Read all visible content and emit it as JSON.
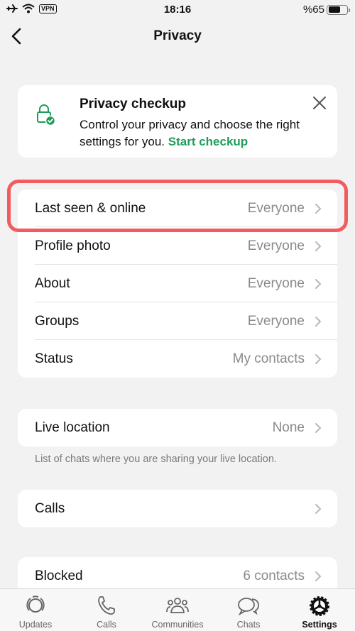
{
  "status_bar": {
    "time": "18:16",
    "vpn_label": "VPN",
    "battery_text": "%65",
    "battery_level_percent": 65,
    "icons": [
      "airplane-icon",
      "wifi-icon",
      "vpn-badge",
      "battery-icon"
    ]
  },
  "header": {
    "title": "Privacy",
    "back_icon": "chevron-left-icon"
  },
  "checkup_card": {
    "title": "Privacy checkup",
    "text": "Control your privacy and choose the right settings for you.",
    "link": "Start checkup",
    "icon": "lock-check-icon",
    "close_icon": "close-icon",
    "accent": "#1e9e5a"
  },
  "privacy_list": [
    {
      "label": "Last seen & online",
      "value": "Everyone"
    },
    {
      "label": "Profile photo",
      "value": "Everyone"
    },
    {
      "label": "About",
      "value": "Everyone"
    },
    {
      "label": "Groups",
      "value": "Everyone"
    },
    {
      "label": "Status",
      "value": "My contacts"
    }
  ],
  "live_location": {
    "label": "Live location",
    "value": "None",
    "footnote": "List of chats where you are sharing your live location."
  },
  "calls": {
    "label": "Calls"
  },
  "blocked": {
    "label": "Blocked",
    "value": "6 contacts"
  },
  "highlight_color": "#f25c61",
  "tab_bar": {
    "tabs": [
      {
        "label": "Updates",
        "icon": "updates-icon",
        "active": false
      },
      {
        "label": "Calls",
        "icon": "phone-icon",
        "active": false
      },
      {
        "label": "Communities",
        "icon": "communities-icon",
        "active": false
      },
      {
        "label": "Chats",
        "icon": "chats-icon",
        "active": false
      },
      {
        "label": "Settings",
        "icon": "settings-gear-icon",
        "active": true
      }
    ]
  }
}
